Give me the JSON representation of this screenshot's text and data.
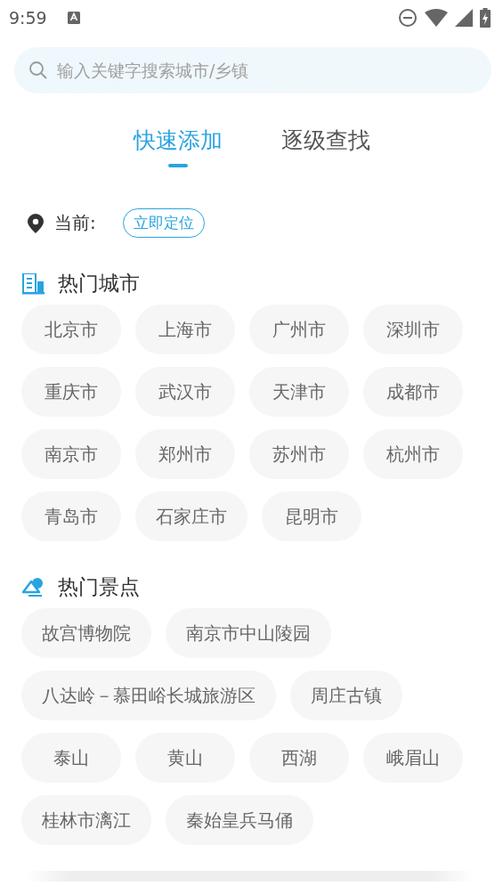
{
  "status_bar": {
    "time": "9:59"
  },
  "search": {
    "placeholder": "输入关键字搜索城市/乡镇"
  },
  "tabs": [
    {
      "label": "快速添加",
      "selected": true
    },
    {
      "label": "逐级查找",
      "selected": false
    }
  ],
  "current": {
    "label": "当前:",
    "button": "立即定位"
  },
  "sections": [
    {
      "kind": "cities",
      "title": "热门城市",
      "items": [
        "北京市",
        "上海市",
        "广州市",
        "深圳市",
        "重庆市",
        "武汉市",
        "天津市",
        "成都市",
        "南京市",
        "郑州市",
        "苏州市",
        "杭州市",
        "青岛市",
        "石家庄市",
        "昆明市"
      ]
    },
    {
      "kind": "spots",
      "title": "热门景点",
      "items": [
        "故宫博物院",
        "南京市中山陵园",
        "八达岭－慕田峪长城旅游区",
        "周庄古镇",
        "泰山",
        "黄山",
        "西湖",
        "峨眉山",
        "桂林市漓江",
        "秦始皇兵马俑"
      ]
    }
  ]
}
